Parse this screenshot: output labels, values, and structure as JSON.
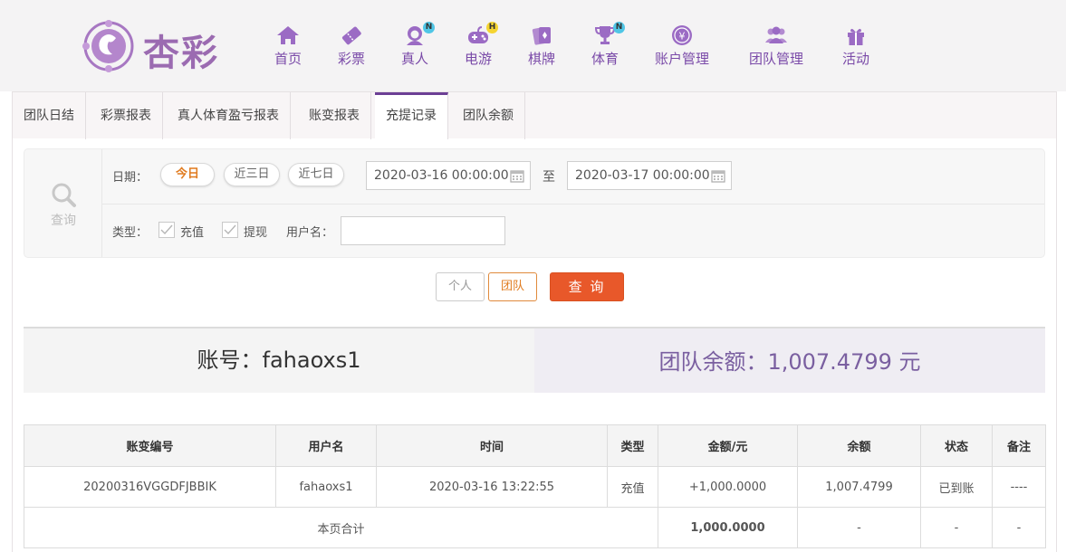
{
  "brand": {
    "name": "杏彩"
  },
  "nav": [
    {
      "label": "首页",
      "icon": "home-icon",
      "badge": ""
    },
    {
      "label": "彩票",
      "icon": "lottery-ticket-icon",
      "badge": ""
    },
    {
      "label": "真人",
      "icon": "live-dealer-icon",
      "badge": "N"
    },
    {
      "label": "电游",
      "icon": "gamepad-icon",
      "badge": "H"
    },
    {
      "label": "棋牌",
      "icon": "playing-cards-icon",
      "badge": ""
    },
    {
      "label": "体育",
      "icon": "trophy-icon",
      "badge": "N"
    },
    {
      "label": "账户管理",
      "icon": "yen-coin-icon",
      "badge": ""
    },
    {
      "label": "团队管理",
      "icon": "team-users-icon",
      "badge": ""
    },
    {
      "label": "活动",
      "icon": "gift-icon",
      "badge": ""
    }
  ],
  "tabs": [
    {
      "label": "团队日结",
      "active": false
    },
    {
      "label": "彩票报表",
      "active": false
    },
    {
      "label": "真人体育盈亏报表",
      "active": false
    },
    {
      "label": "账变报表",
      "active": false
    },
    {
      "label": "充提记录",
      "active": true
    },
    {
      "label": "团队余额",
      "active": false
    }
  ],
  "filter": {
    "search_label": "查询",
    "date_label": "日期：",
    "quick_ranges": [
      "今日",
      "近三日",
      "近七日"
    ],
    "active_range": "今日",
    "date_from": "2020-03-16 00:00:00",
    "to_label": "至",
    "date_to": "2020-03-17 00:00:00",
    "type_label": "类型：",
    "types": [
      {
        "label": "充值",
        "checked": true
      },
      {
        "label": "提现",
        "checked": true
      }
    ],
    "username_label": "用户名：",
    "username_value": ""
  },
  "actions": {
    "personal": "个人",
    "team": "团队",
    "query": "查 询"
  },
  "summary": {
    "account_text": "账号：fahaoxs1",
    "balance_text": "团队余额：1,007.4799 元"
  },
  "table": {
    "headers": [
      "账变编号",
      "用户名",
      "时间",
      "类型",
      "金额/元",
      "余额",
      "状态",
      "备注"
    ],
    "rows": [
      {
        "id": "20200316VGGDFJBBIK",
        "user": "fahaoxs1",
        "time": "2020-03-16 13:22:55",
        "type": "充值",
        "amount": "+1,000.0000",
        "balance": "1,007.4799",
        "status": "已到账",
        "note": "----"
      }
    ],
    "total": {
      "label": "本页合计",
      "amount": "1,000.0000",
      "balance": "-",
      "status": "-",
      "note": "-"
    }
  },
  "colors": {
    "brand_purple": "#7a4aa8",
    "accent_orange": "#e8582a",
    "positive_green": "#5a9a1e"
  }
}
